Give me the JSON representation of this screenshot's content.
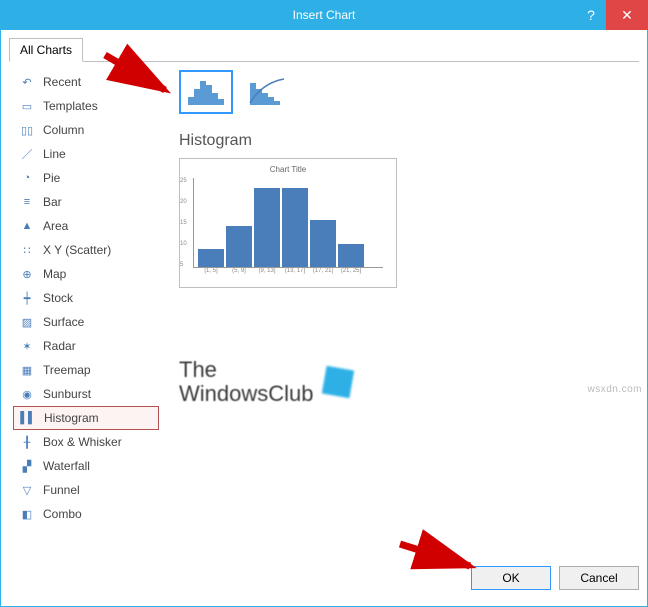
{
  "window": {
    "title": "Insert Chart",
    "help_label": "?",
    "close_label": "✕"
  },
  "tabs": {
    "active": "All Charts"
  },
  "sidebar": {
    "items": [
      {
        "label": "Recent",
        "icon": "undo-icon"
      },
      {
        "label": "Templates",
        "icon": "folder-icon"
      },
      {
        "label": "Column",
        "icon": "column-icon"
      },
      {
        "label": "Line",
        "icon": "line-icon"
      },
      {
        "label": "Pie",
        "icon": "pie-icon"
      },
      {
        "label": "Bar",
        "icon": "bar-icon"
      },
      {
        "label": "Area",
        "icon": "area-icon"
      },
      {
        "label": "X Y (Scatter)",
        "icon": "scatter-icon"
      },
      {
        "label": "Map",
        "icon": "map-icon"
      },
      {
        "label": "Stock",
        "icon": "stock-icon"
      },
      {
        "label": "Surface",
        "icon": "surface-icon"
      },
      {
        "label": "Radar",
        "icon": "radar-icon"
      },
      {
        "label": "Treemap",
        "icon": "treemap-icon"
      },
      {
        "label": "Sunburst",
        "icon": "sunburst-icon"
      },
      {
        "label": "Histogram",
        "icon": "histogram-icon"
      },
      {
        "label": "Box & Whisker",
        "icon": "box-icon"
      },
      {
        "label": "Waterfall",
        "icon": "waterfall-icon"
      },
      {
        "label": "Funnel",
        "icon": "funnel-icon"
      },
      {
        "label": "Combo",
        "icon": "combo-icon"
      }
    ],
    "selected_index": 14
  },
  "main": {
    "heading": "Histogram",
    "subtypes": [
      {
        "name": "histogram-subtype",
        "selected": true
      },
      {
        "name": "pareto-subtype",
        "selected": false
      }
    ]
  },
  "chart_data": {
    "type": "bar",
    "title": "Chart Title",
    "xlabel": "",
    "ylabel": "",
    "ylim": [
      0,
      30
    ],
    "yticks": [
      5,
      10,
      15,
      20,
      25
    ],
    "categories": [
      "[1, 5]",
      "(5, 9]",
      "(9, 13]",
      "(13, 17]",
      "(17, 21]",
      "(21, 25]"
    ],
    "values": [
      6,
      14,
      27,
      27,
      16,
      8
    ]
  },
  "watermark": {
    "line1": "The",
    "line2": "WindowsClub",
    "domain": "wsxdn.com"
  },
  "footer": {
    "ok": "OK",
    "cancel": "Cancel"
  }
}
